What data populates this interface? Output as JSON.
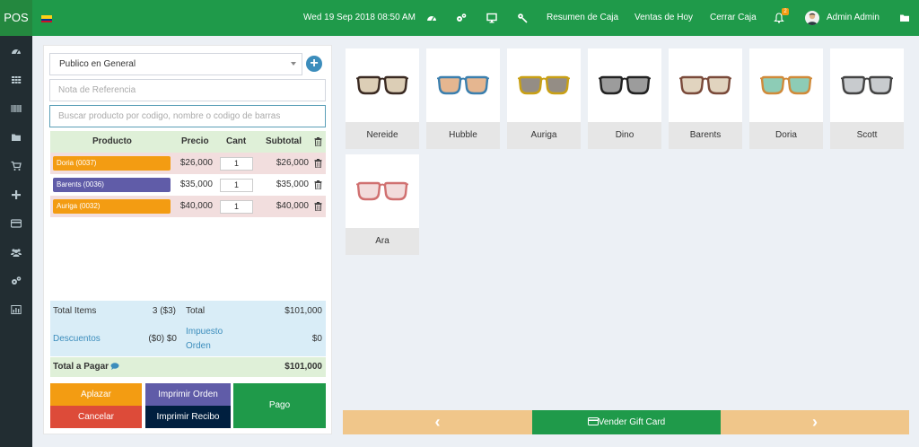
{
  "app": {
    "brand": "POS"
  },
  "topbar": {
    "datetime": "Wed 19 Sep 2018 08:50 AM",
    "resumen": "Resumen de Caja",
    "ventas": "Ventas de Hoy",
    "cerrar": "Cerrar Caja",
    "notif_count": "2",
    "user": "Admin Admin"
  },
  "customer": {
    "selected": "Publico en General"
  },
  "reference": {
    "placeholder": "Nota de Referencia"
  },
  "search": {
    "placeholder": "Buscar producto por codigo, nombre o codigo de barras"
  },
  "table": {
    "headers": {
      "producto": "Producto",
      "precio": "Precio",
      "cant": "Cant",
      "subtotal": "Subtotal"
    },
    "rows": [
      {
        "name": "Doria (0037)",
        "color": "#f39c12",
        "price": "$26,000",
        "qty": "1",
        "subtotal": "$26,000"
      },
      {
        "name": "Barents (0036)",
        "color": "#605ca8",
        "price": "$35,000",
        "qty": "1",
        "subtotal": "$35,000"
      },
      {
        "name": "Auriga (0032)",
        "color": "#f39c12",
        "price": "$40,000",
        "qty": "1",
        "subtotal": "$40,000"
      }
    ]
  },
  "totals": {
    "items_label": "Total Items",
    "items_value": "3 ($3)",
    "total_label": "Total",
    "total_value": "$101,000",
    "desc_label": "Descuentos",
    "desc_value": "($0) $0",
    "tax_label_1": "Impuesto",
    "tax_label_2": "Orden",
    "tax_value": "$0",
    "pay_label": "Total a Pagar",
    "pay_value": "$101,000"
  },
  "buttons": {
    "aplazar": "Aplazar",
    "cancelar": "Cancelar",
    "imprimir_orden": "Imprimir Orden",
    "imprimir_recibo": "Imprimir Recibo",
    "pago": "Pago"
  },
  "products": [
    {
      "name": "Nereide",
      "frame": "#3a2a22",
      "lens": "#bfa57a"
    },
    {
      "name": "Hubble",
      "frame": "#3b7fae",
      "lens": "#d07a34"
    },
    {
      "name": "Auriga",
      "frame": "#c9a014",
      "lens": "#3d2f20"
    },
    {
      "name": "Dino",
      "frame": "#222222",
      "lens": "#4a4a4a"
    },
    {
      "name": "Barents",
      "frame": "#7a4a3a",
      "lens": "#c8b08a"
    },
    {
      "name": "Doria",
      "frame": "#d08a3a",
      "lens": "#2fa37a"
    },
    {
      "name": "Scott",
      "frame": "#444444",
      "lens": "#9aa0a6"
    },
    {
      "name": "Ara",
      "frame": "#d07070",
      "lens": "#e8c0c0"
    }
  ],
  "footer": {
    "gift_card": "Vender Gift Card",
    "prev": "‹",
    "next": "›"
  },
  "colors": {
    "green": "#1f9a4a",
    "sidebar": "#222d32",
    "orange": "#f39c12",
    "red": "#dd4b39",
    "purple": "#605ca8",
    "navy": "#001f3f",
    "tan": "#f0c68a"
  }
}
